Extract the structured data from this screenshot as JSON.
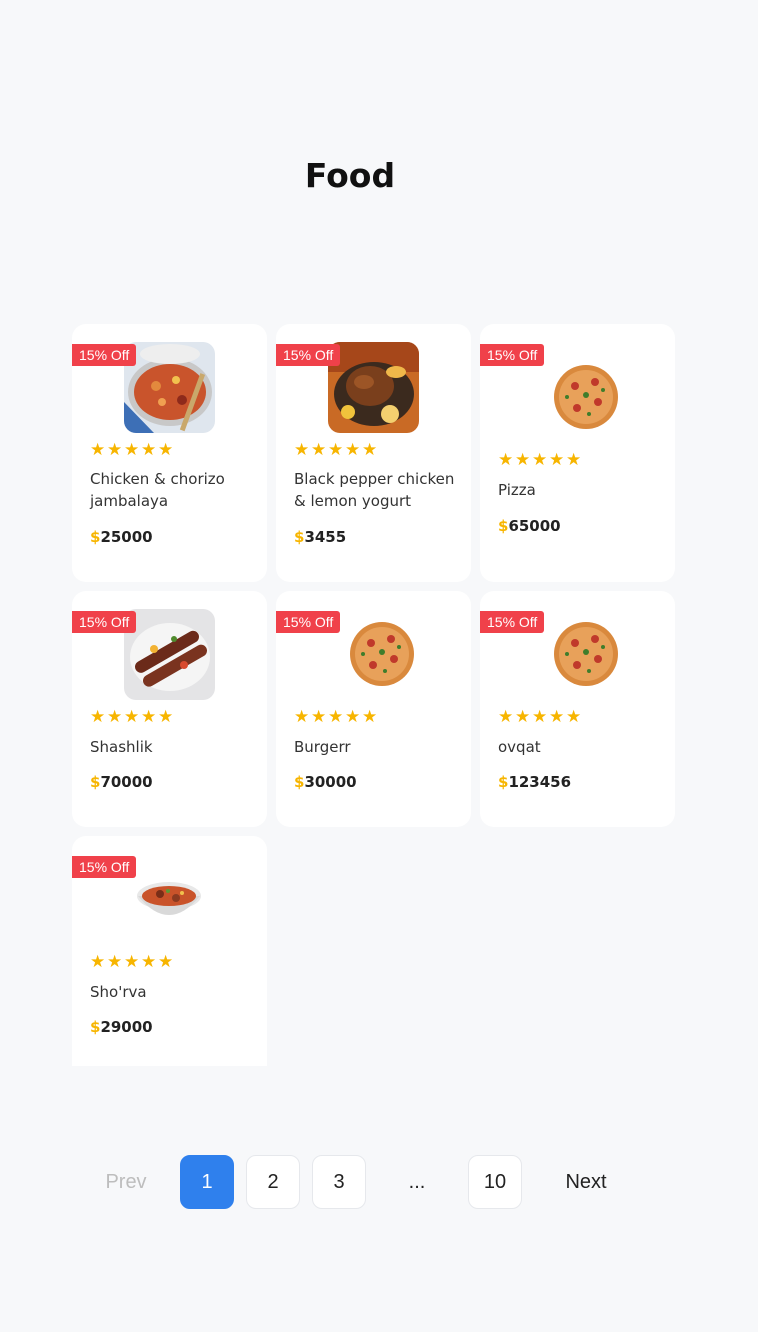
{
  "page": {
    "title": "Food"
  },
  "badge_text": "15% Off",
  "currency": "$",
  "colors": {
    "accent": "#2f80ed",
    "badge": "#f0414a",
    "star": "#f7b500",
    "background": "#f7f8fa"
  },
  "products": [
    {
      "name": "Chicken & chorizo jambalaya",
      "price": "25000",
      "rating": 5,
      "image": "jambalaya-photo"
    },
    {
      "name": "Black pepper chicken & lemon yogurt",
      "price": "3455",
      "rating": 5,
      "image": "roast-chicken-photo"
    },
    {
      "name": "Pizza",
      "price": "65000",
      "rating": 5,
      "image": "pizza-photo"
    },
    {
      "name": "Shashlik",
      "price": "70000",
      "rating": 5,
      "image": "shashlik-photo"
    },
    {
      "name": "Burgerr",
      "price": "30000",
      "rating": 5,
      "image": "pizza-photo"
    },
    {
      "name": "ovqat",
      "price": "123456",
      "rating": 5,
      "image": "pizza-photo"
    },
    {
      "name": "Sho'rva",
      "price": "29000",
      "rating": 5,
      "image": "soup-photo"
    }
  ],
  "pagination": {
    "prev": "Prev",
    "next": "Next",
    "pages": [
      "1",
      "2",
      "3",
      "...",
      "10"
    ],
    "current": "1"
  }
}
